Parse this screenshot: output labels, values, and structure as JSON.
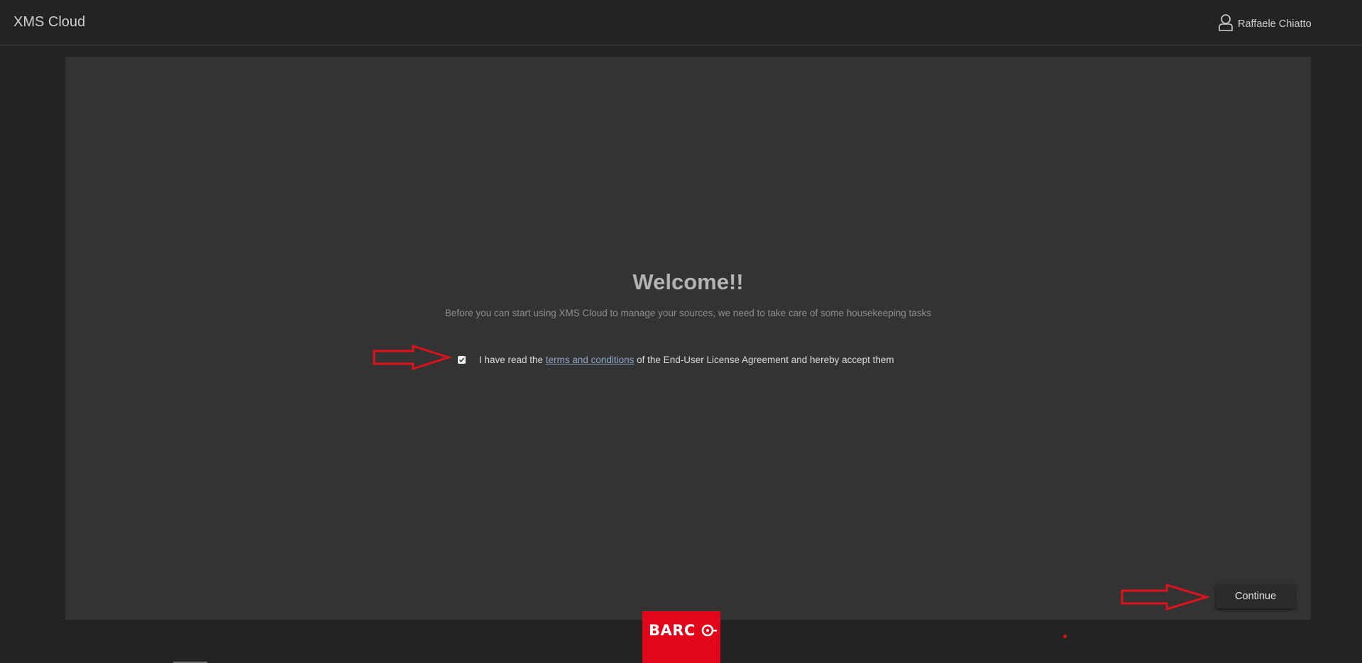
{
  "header": {
    "app_title": "XMS Cloud",
    "user_name": "Raffaele Chiatto",
    "user_icon": "user-icon"
  },
  "welcome": {
    "title": "Welcome!!",
    "subtitle": "Before you can start using XMS Cloud to manage your sources, we need to take care of some housekeeping tasks"
  },
  "agreement": {
    "checked": true,
    "text_before": "I have read the ",
    "link_text": "terms and conditions",
    "text_after": " of the End-User License Agreement and hereby accept them"
  },
  "actions": {
    "continue_label": "Continue"
  },
  "footer": {
    "brand_logo": "BARCO",
    "brand_color": "#e2061b"
  },
  "annotations": {
    "arrow_color": "#e0111b"
  },
  "colors": {
    "background": "#232323",
    "panel": "#333333",
    "link": "#8fa6c4"
  }
}
